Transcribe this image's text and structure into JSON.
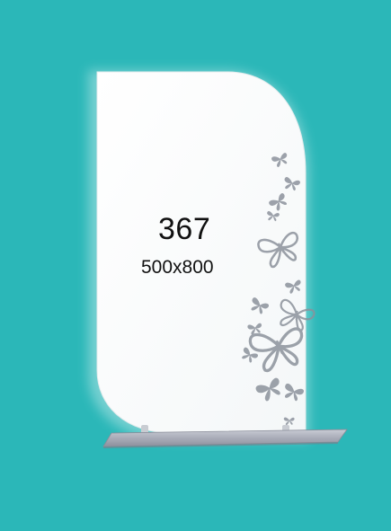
{
  "product": {
    "model_number": "367",
    "dimensions": "500x800"
  },
  "colors": {
    "background": "#2bb7b8",
    "mirror": "#ffffff",
    "shelf": "#a9acb8",
    "butterfly": "#8c929c"
  },
  "icons": [
    "butterfly-decal-icon"
  ]
}
